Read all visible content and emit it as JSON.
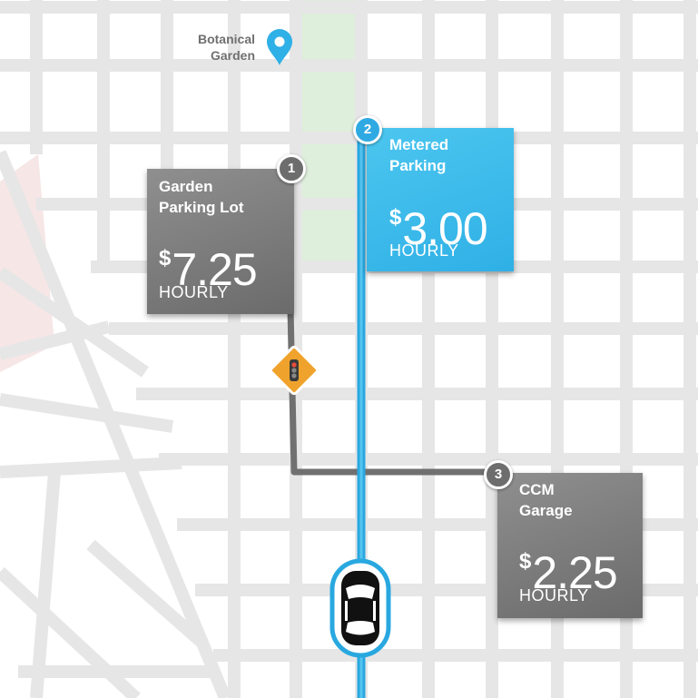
{
  "map": {
    "colors": {
      "background": "#ffffff",
      "street": "#e6e6e6",
      "park": "#deefdb",
      "zone": "#f6e6e6",
      "route_active": "#29a8e0",
      "route_alt": "#707070",
      "poi": "#2fb0e6",
      "traffic_light_sign": "#f0a32c"
    },
    "poi": {
      "name": "Botanical\nGarden",
      "icon": "location-pin-icon"
    },
    "traffic_light": {
      "icon": "traffic-light-icon"
    },
    "vehicle": {
      "icon": "car-icon"
    }
  },
  "parking": [
    {
      "number": "1",
      "name": "Garden\nParking Lot",
      "currency": "$",
      "price": "7.25",
      "unit": "HOURLY",
      "selected": false
    },
    {
      "number": "2",
      "name": "Metered\nParking",
      "currency": "$",
      "price": "3.00",
      "unit": "HOURLY",
      "selected": true
    },
    {
      "number": "3",
      "name": "CCM\nGarage",
      "currency": "$",
      "price": "2.25",
      "unit": "HOURLY",
      "selected": false
    }
  ]
}
